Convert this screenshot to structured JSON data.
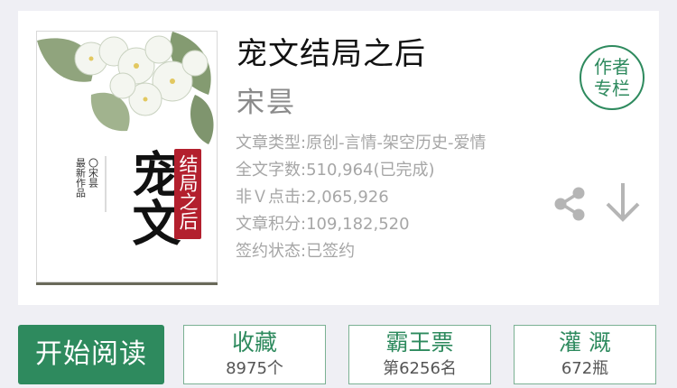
{
  "book": {
    "title": "宠文结局之后",
    "author": "宋昙",
    "cover": {
      "title_main": "宠文",
      "title_seal": "结局之后",
      "author_sig": "〇宋昙",
      "badge": "最新作品",
      "colors": {
        "seal": "#b3202e",
        "ink": "#111111",
        "leaf": "#6f8a58",
        "petal": "#f4f6f0"
      }
    },
    "meta": [
      "文章类型:原创-言情-架空历史-爱情",
      "全文字数:510,964(已完成)",
      "非Ｖ点击:2,065,926",
      "文章积分:109,182,520",
      "签约状态:已签约"
    ]
  },
  "author_column": {
    "line1": "作者",
    "line2": "专栏"
  },
  "icons": {
    "share": "share-icon",
    "download": "download-arrow-icon"
  },
  "actions": {
    "read_label": "开始阅读",
    "stats": [
      {
        "label": "收藏",
        "value": "8975个"
      },
      {
        "label": "霸王票",
        "value": "第6256名"
      },
      {
        "label": "灌 溉",
        "value": "672瓶"
      }
    ]
  },
  "colors": {
    "accent": "#2e8a5e",
    "meta_text": "#a6a6a6",
    "background": "#efeff4"
  }
}
